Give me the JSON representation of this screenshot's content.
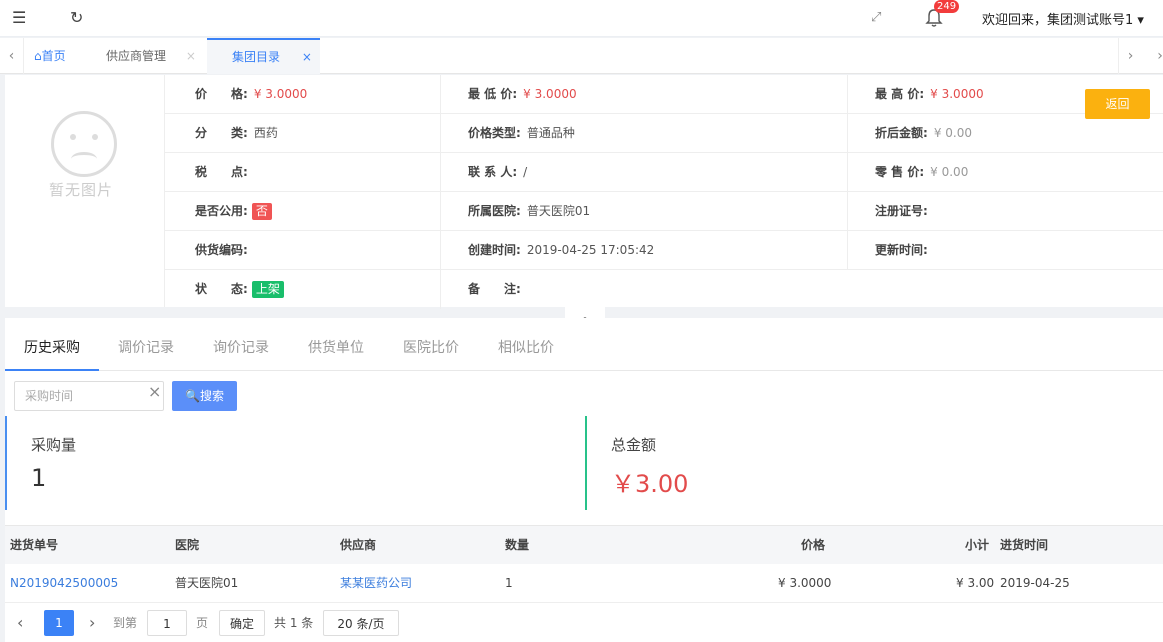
{
  "header": {
    "badge_count": "249",
    "welcome": "欢迎回来，集团测试账号1 ▾"
  },
  "tabs": [
    {
      "label": "⌂首页"
    },
    {
      "label": "供应商管理"
    },
    {
      "label": "集团目录"
    }
  ],
  "detail": {
    "no_image_text": "暂无图片",
    "return_label": "返回",
    "rows": [
      {
        "label1": "价　　格:",
        "value1": "¥ 3.0000",
        "label2": "最 低 价:",
        "value2": "¥ 3.0000",
        "label3": "最 高 价:",
        "value3": "¥ 3.0000"
      },
      {
        "label1": "分　　类:",
        "value1": "西药",
        "label2": "价格类型:",
        "value2": "普通品种",
        "label3": "折后金额:",
        "value3": "¥ 0.00"
      },
      {
        "label1": "税　　点:",
        "value1": "",
        "label2": "联 系 人:",
        "value2": "/",
        "label3": "零 售 价:",
        "value3": "¥ 0.00"
      },
      {
        "label1": "是否公用:",
        "value1": "否",
        "label2": "所属医院:",
        "value2": "普天医院01",
        "label3": "注册证号:",
        "value3": ""
      },
      {
        "label1": "供货编码:",
        "value1": "",
        "label2": "创建时间:",
        "value2": "2019-04-25 17:05:42",
        "label3": "更新时间:",
        "value3": ""
      },
      {
        "label1": "状　　态:",
        "value1": "上架",
        "label2": "备　　注:",
        "value2": ""
      }
    ]
  },
  "subtabs": [
    "历史采购",
    "调价记录",
    "询价记录",
    "供货单位",
    "医院比价",
    "相似比价"
  ],
  "search": {
    "placeholder": "采购时间",
    "button_label": "搜索"
  },
  "stats": {
    "qty_title": "采购量",
    "qty_value": "1",
    "amount_title": "总金额",
    "amount_value": "￥3.00"
  },
  "table": {
    "headers": [
      "进货单号",
      "医院",
      "供应商",
      "数量",
      "价格",
      "小计",
      "进货时间"
    ],
    "rows": [
      [
        "N2019042500005",
        "普天医院01",
        "某某医药公司",
        "1",
        "¥ 3.0000",
        "¥ 3.00",
        "2019-04-25"
      ]
    ]
  },
  "pager": {
    "current_page": "1",
    "goto_label": "到第",
    "page_input": "1",
    "page_unit": "页",
    "confirm_label": "确定",
    "total_label": "共 1 条",
    "page_size": "20 条/页"
  },
  "colors": {
    "accent": "#3b82f6",
    "price_red": "#e24b4b",
    "return_button": "#fbb10f",
    "tag_no": "#f05454",
    "tag_on": "#19be6b"
  }
}
